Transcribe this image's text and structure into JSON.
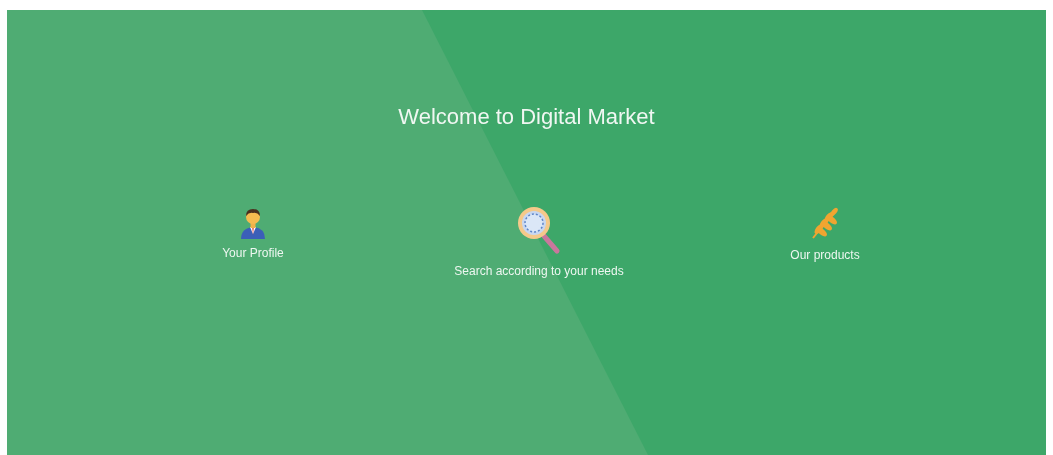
{
  "hero": {
    "title": "Welcome to Digital Market"
  },
  "features": [
    {
      "kind": "profile",
      "label": "Your Profile"
    },
    {
      "kind": "search",
      "label": "Search according to your needs"
    },
    {
      "kind": "products",
      "label": "Our products"
    }
  ]
}
